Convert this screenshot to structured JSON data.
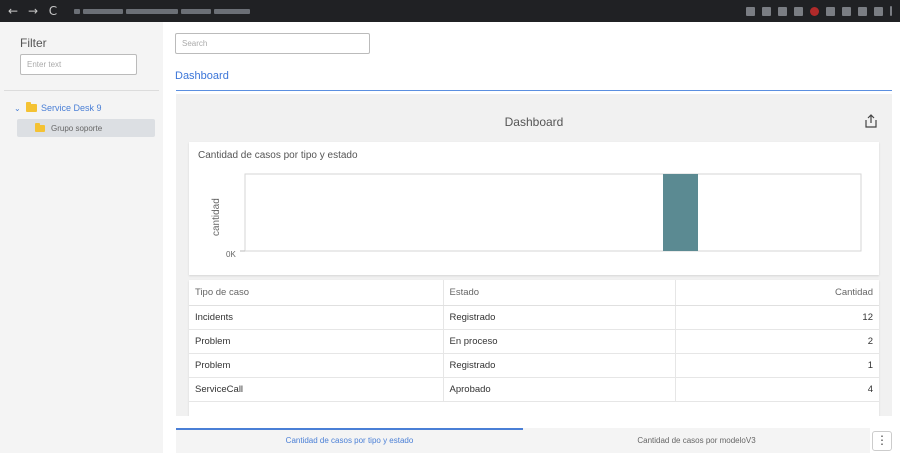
{
  "browser": {
    "back_icon": "←",
    "forward_icon": "→",
    "reload_icon": "C"
  },
  "sidebar": {
    "filter_title": "Filter",
    "filter_placeholder": "Enter text",
    "tree": {
      "root_label": "Service Desk 9",
      "child_label": "Grupo soporte"
    }
  },
  "main": {
    "search_placeholder": "Search",
    "tab_label": "Dashboard",
    "panel_title": "Dashboard"
  },
  "chart_data": {
    "type": "bar",
    "title": "Cantidad de casos por tipo y estado",
    "ylabel": "cantidad",
    "xlabel": "",
    "y_tick_labels": [
      "0K"
    ],
    "bar_color": "#5b8a92"
  },
  "table": {
    "headers": [
      "Tipo de caso",
      "Estado",
      "Cantidad"
    ],
    "rows": [
      [
        "Incidents",
        "Registrado",
        "12"
      ],
      [
        "Problem",
        "En proceso",
        "2"
      ],
      [
        "Problem",
        "Registrado",
        "1"
      ],
      [
        "ServiceCall",
        "Aprobado",
        "4"
      ]
    ]
  },
  "bottom_tabs": [
    {
      "label": "Cantidad de casos por tipo y estado",
      "active": true
    },
    {
      "label": "Cantidad de casos por modeloV3",
      "active": false
    }
  ],
  "more_icon": "⋮",
  "colors": {
    "accent": "#4a7fd6",
    "bar": "#5b8a92",
    "folder": "#f4c233"
  }
}
